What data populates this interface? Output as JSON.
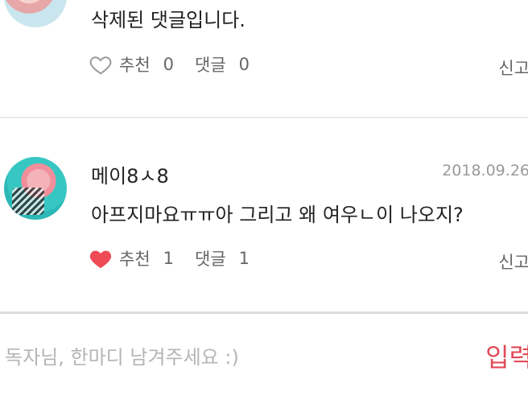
{
  "comments": [
    {
      "text": "삭제된 댓글입니다.",
      "recommend_label": "추천",
      "recommend_count": "0",
      "reply_label": "댓글",
      "reply_count": "0",
      "report_label": "신고",
      "liked": false
    },
    {
      "author": "메이8ㅅ8",
      "date": "2018.09.26",
      "text": "아프지마요ㅠㅠ아 그리고 왜 여우ㄴ이 나오지?",
      "recommend_label": "추천",
      "recommend_count": "1",
      "reply_label": "댓글",
      "reply_count": "1",
      "report_label": "신고",
      "liked": true
    }
  ],
  "input": {
    "placeholder": "독자님, 한마디 남겨주세요 :)",
    "submit_label": "입력"
  },
  "colors": {
    "accent": "#e14b57",
    "heart_liked": "#ef4b57",
    "muted": "#9a9a9a"
  },
  "icons": {
    "heart_outline": "heart-outline-icon",
    "heart_filled": "heart-filled-icon"
  }
}
